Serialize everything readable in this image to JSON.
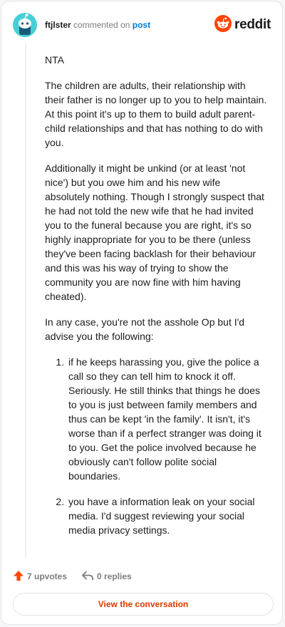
{
  "header": {
    "username": "ftjlster",
    "commented_text": "commented on",
    "post_link": "post",
    "brand": "reddit"
  },
  "comment": {
    "paragraphs": [
      "NTA",
      "The children are adults, their relationship with their father is no longer up to you to help maintain. At this point it's up to them to build adult parent-child relationships and that has nothing to do with you.",
      "Additionally it might be unkind (or at least 'not nice') but you owe him and his new wife absolutely nothing. Though I strongly suspect that he had not told the new wife that he had invited you to the funeral because you are right, it's so highly inappropriate for you to be there (unless they've been facing backlash for their behaviour and this was his way of trying to show the community you are now fine with him having cheated).",
      "In any case, you're not the asshole Op but I'd advise you the following:"
    ],
    "list": [
      "if he keeps harassing you, give the police a call so they can tell him to knock it off. Seriously. He still thinks that things he does to you is just between family members and thus can be kept 'in the family'. It isn't, it's worse than if a perfect stranger was doing it to you. Get the police involved because he obviously can't follow polite social boundaries.",
      "you have a information leak on your social media. I'd suggest reviewing your social media privacy settings."
    ]
  },
  "footer": {
    "upvotes": "7 upvotes",
    "replies": "0 replies",
    "view_button": "View the conversation"
  },
  "colors": {
    "upvote": "#ff4500",
    "link": "#0079d3",
    "button_text": "#d93a00",
    "avatar": "#46d0d6"
  },
  "icons": {
    "avatar": "snoo-avatar-icon",
    "brand": "reddit-logo-icon",
    "upvote": "upvote-arrow-icon",
    "reply": "reply-arrow-icon"
  }
}
